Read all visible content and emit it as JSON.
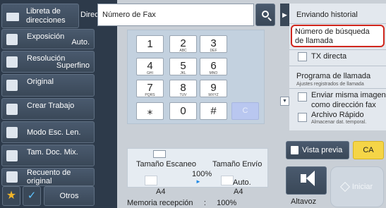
{
  "address": {
    "book_label_line1": "Libreta de",
    "book_label_line2": "direcciones",
    "dir_label": "Dirección",
    "value": "Número de Fax"
  },
  "left_menu": [
    {
      "label": "Exposición",
      "value": "Auto.",
      "icon": "exposure-icon"
    },
    {
      "label": "Resolución",
      "value": "Superfino",
      "icon": "resolution-icon"
    },
    {
      "label": "Original",
      "value": "",
      "icon": "original-icon"
    },
    {
      "label": "Crear Trabajo",
      "value": "",
      "icon": "job-build-icon"
    },
    {
      "label": "Modo Esc. Len.",
      "value": "",
      "icon": "slow-scan-icon"
    },
    {
      "label": "Tam. Doc. Mix.",
      "value": "",
      "icon": "mixed-size-icon"
    },
    {
      "label": "Recuento de original",
      "value": "",
      "icon": "original-count-icon"
    }
  ],
  "bottom_left": {
    "star": "★",
    "check": "✓",
    "otros": "Otros"
  },
  "keypad": {
    "keys": [
      {
        "n": "1",
        "s": ""
      },
      {
        "n": "2",
        "s": "ABC"
      },
      {
        "n": "3",
        "s": "DEF"
      },
      {
        "n": "4",
        "s": "GHI"
      },
      {
        "n": "5",
        "s": "JKL"
      },
      {
        "n": "6",
        "s": "MNO"
      },
      {
        "n": "7",
        "s": "PQRS"
      },
      {
        "n": "8",
        "s": "TUV"
      },
      {
        "n": "9",
        "s": "WXYZ"
      },
      {
        "n": "⁎",
        "s": ""
      },
      {
        "n": "0",
        "s": ""
      },
      {
        "n": "#",
        "s": ""
      }
    ],
    "clear": "C"
  },
  "info": {
    "scan_size": "Tamaño Escaneo",
    "send_size": "Tamaño Envío",
    "ratio": "100%",
    "auto": "Auto.",
    "paper_left": "A4",
    "paper_right": "A4",
    "memory": "Memoria recepción     :     100%"
  },
  "right_panel": {
    "history": "Enviando historial",
    "search_line1": "Número de búsqueda",
    "search_line2": "de llamada",
    "tx_directa": "TX directa",
    "programa": "Programa de llamada",
    "programa_sub": "Ajustes registrados de llamada",
    "send_same_line1": "Enviar misma imagen",
    "send_same_line2": "como dirección  fax",
    "archivo": "Archivo Rápido",
    "archivo_sub": "Almacenar dat. temporal."
  },
  "actions": {
    "preview": "Vista previa",
    "ca": "CA",
    "altavoz": "Altavoz",
    "iniciar": "Iniciar"
  },
  "colors": {
    "sidebar": "#2d3a4a",
    "button": "#3a4858",
    "highlight": "#d0271d",
    "ca": "#f5d547"
  }
}
